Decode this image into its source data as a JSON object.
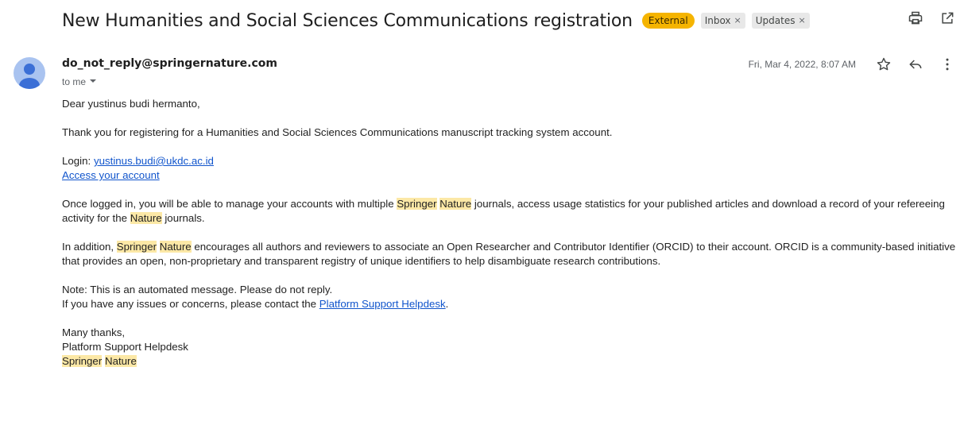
{
  "header": {
    "subject": "New Humanities and Social Sciences Communications registration",
    "labels": {
      "external": "External",
      "inbox": "Inbox",
      "updates": "Updates",
      "remove_glyph": "×"
    },
    "icons": [
      "print-icon",
      "open-in-new-window-icon"
    ]
  },
  "message": {
    "sender": "do_not_reply@springernature.com",
    "recipient": "to me",
    "date": "Fri, Mar 4, 2022, 8:07 AM",
    "icons": [
      "avatar-icon",
      "star-icon",
      "reply-icon",
      "more-vert-icon",
      "chevron-down-icon"
    ],
    "body": {
      "greeting": "Dear yustinus budi hermanto,",
      "para_thanks": "Thank you for registering for a Humanities and Social Sciences Communications manuscript tracking system account.",
      "login_label": "Login: ",
      "login_email": "yustinus.budi@ukdc.ac.id",
      "access_link": "Access your account",
      "p3_a": "Once logged in, you will be able to manage your accounts with multiple ",
      "springer": "Springer",
      "nature": "Nature",
      "p3_b": " journals, access usage statistics for your published articles and download a record of your refereeing activity for the ",
      "p3_c": " journals.",
      "p4_a": "In addition, ",
      "p4_b": " encourages all authors and reviewers to associate an Open Researcher and Contributor Identifier (ORCID) to their account. ORCID is a community-based initiative that provides an open, non-proprietary and transparent registry of unique identifiers to help disambiguate research contributions.",
      "note_line": "Note: This is an automated message. Please do not reply.",
      "issues_prefix": "If you have any issues or concerns, please contact the ",
      "helpdesk_link": "Platform Support Helpdesk",
      "issues_suffix": ".",
      "signoff": "Many thanks,",
      "sig_team": "Platform Support Helpdesk"
    }
  },
  "colors": {
    "external_label": "#f5b400",
    "highlight": "#fce8a6",
    "link": "#1155cc",
    "avatar": "#a9c3f0"
  }
}
